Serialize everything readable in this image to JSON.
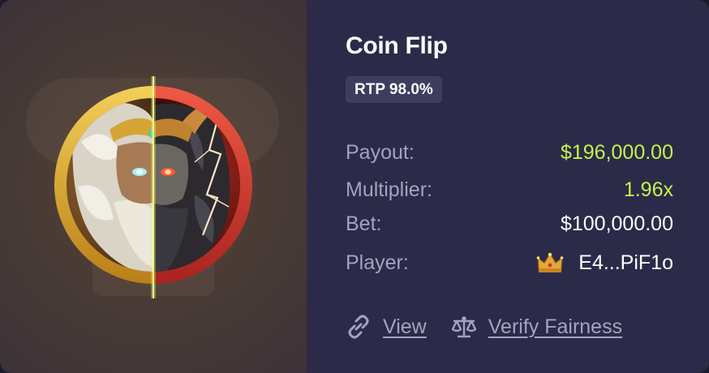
{
  "game": {
    "title": "Coin Flip",
    "rtp_badge": "RTP 98.0%"
  },
  "stats": {
    "payout": {
      "label": "Payout:",
      "value": "$196,000.00"
    },
    "multiplier": {
      "label": "Multiplier:",
      "value": "1.96x"
    },
    "bet": {
      "label": "Bet:",
      "value": "$100,000.00"
    },
    "player": {
      "label": "Player:",
      "value": "E4...PiF1o",
      "badge_icon": "crown-icon"
    }
  },
  "links": {
    "view": {
      "label": "View",
      "icon": "link-icon"
    },
    "verify": {
      "label": "Verify Fairness",
      "icon": "scale-icon"
    }
  },
  "colors": {
    "card_bg": "#2b2b49",
    "accent_green": "#c7f24a",
    "muted_text": "#a3a3c1",
    "badge_bg": "#3d3d5e",
    "coin_gold": "#e2b233",
    "coin_red": "#d8403a",
    "divider_glow": "#e6f56a"
  },
  "coin": {
    "left_half": "gold-zeus",
    "right_half": "red-hades"
  }
}
